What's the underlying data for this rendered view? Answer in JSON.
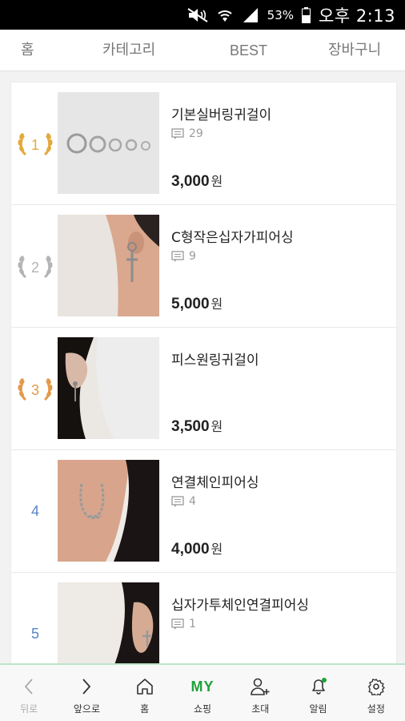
{
  "status_bar": {
    "battery": "53%",
    "time": "오후 2:13"
  },
  "tabs": [
    {
      "label": "홈"
    },
    {
      "label": "카테고리"
    },
    {
      "label": "BEST"
    },
    {
      "label": "장바구니"
    }
  ],
  "products": [
    {
      "rank": "1",
      "name": "기본실버링귀걸이",
      "comments": "29",
      "price": "3,000",
      "currency": "원",
      "badge": "gold"
    },
    {
      "rank": "2",
      "name": "C형작은십자가피어싱",
      "comments": "9",
      "price": "5,000",
      "currency": "원",
      "badge": "silver"
    },
    {
      "rank": "3",
      "name": "피스원링귀걸이",
      "comments": "",
      "price": "3,500",
      "currency": "원",
      "badge": "bronze"
    },
    {
      "rank": "4",
      "name": "연결체인피어싱",
      "comments": "4",
      "price": "4,000",
      "currency": "원",
      "badge": "none"
    },
    {
      "rank": "5",
      "name": "십자가투체인연결피어싱",
      "comments": "1",
      "price": "",
      "currency": "",
      "badge": "none"
    }
  ],
  "bottom_nav": {
    "back": "뒤로",
    "forward": "앞으로",
    "home": "홈",
    "my_icon_text": "MY",
    "shopping": "쇼핑",
    "invite": "초대",
    "alarm": "알림",
    "settings": "설정"
  },
  "colors": {
    "accent_green": "#1ea33a",
    "rank_blue": "#5a86c2",
    "gold": "#e3a93a",
    "silver": "#b4b4b4",
    "bronze": "#e29a4a"
  }
}
